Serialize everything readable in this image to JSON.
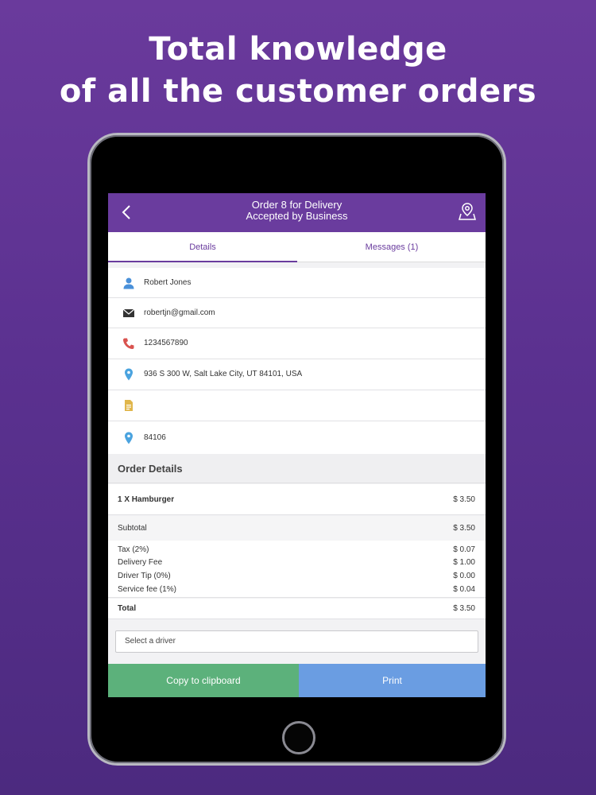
{
  "headline": {
    "line1": "Total knowledge",
    "line2": "of all the customer orders"
  },
  "header": {
    "title": "Order 8 for Delivery",
    "subtitle": "Accepted by Business"
  },
  "tabs": [
    {
      "label": "Details",
      "active": true
    },
    {
      "label": "Messages (1)",
      "active": false
    }
  ],
  "customer": {
    "name": "Robert Jones",
    "email": "robertjn@gmail.com",
    "phone": "1234567890",
    "address": "936 S 300 W, Salt Lake City, UT 84101, USA",
    "note": "",
    "zip": "84106"
  },
  "order": {
    "section_title": "Order Details",
    "item": {
      "label": "1 X Hamburger",
      "price": "$ 3.50"
    },
    "subtotal": {
      "label": "Subtotal",
      "value": "$ 3.50"
    },
    "tax": {
      "label": "Tax (2%)",
      "value": "$ 0.07"
    },
    "delivery_fee": {
      "label": "Delivery Fee",
      "value": "$ 1.00"
    },
    "driver_tip": {
      "label": "Driver Tip (0%)",
      "value": "$ 0.00"
    },
    "service_fee": {
      "label": "Service fee (1%)",
      "value": "$ 0.04"
    },
    "total": {
      "label": "Total",
      "value": "$ 3.50"
    }
  },
  "driver_select": {
    "placeholder": "Select a driver"
  },
  "actions": {
    "copy_label": "Copy to clipboard",
    "print_label": "Print"
  },
  "colors": {
    "brand_purple": "#6a3c9e",
    "copy_green": "#5cb17b",
    "print_blue": "#6a9de2",
    "icon_blue": "#4a90d9",
    "icon_red": "#d9534f",
    "icon_gold": "#e0b64b"
  },
  "icons": {
    "back": "chevron-left-icon",
    "map": "map-pin-icon",
    "user": "user-icon",
    "email": "envelope-icon",
    "phone": "phone-icon",
    "location": "location-pin-icon",
    "note": "document-icon"
  }
}
